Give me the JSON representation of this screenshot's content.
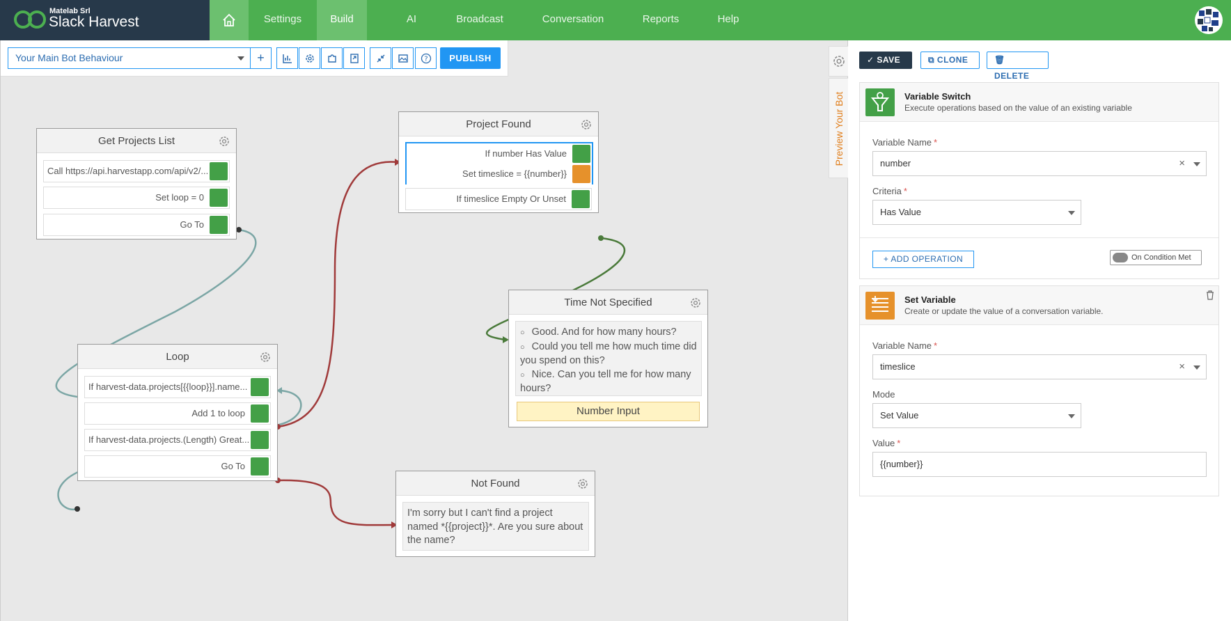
{
  "header": {
    "company": "Matelab Srl",
    "app_name": "Slack Harvest",
    "nav": [
      {
        "label": "Settings"
      },
      {
        "label": "Build"
      },
      {
        "label": "AI"
      },
      {
        "label": "Broadcast"
      },
      {
        "label": "Conversation"
      },
      {
        "label": "Reports"
      },
      {
        "label": "Help"
      }
    ],
    "active_nav": "Build",
    "brand_color": "#4caf50",
    "brand_dark": "#27394a"
  },
  "toolbar": {
    "behaviour_select": "Your Main Bot Behaviour",
    "publish_label": "PUBLISH",
    "tools": [
      "add-icon",
      "chart-icon",
      "gear-icon",
      "puzzle-icon",
      "export-icon",
      "collapse-icon",
      "image-icon",
      "help-icon"
    ]
  },
  "nodes": {
    "get_projects": {
      "title": "Get Projects List",
      "ops": [
        "Call https://api.harvestapp.com/api/v2/...",
        "Set loop = 0",
        "Go To"
      ]
    },
    "project_found": {
      "title": "Project Found",
      "ops": [
        "If number Has Value",
        "Set timeslice = {{number}}",
        "If timeslice Empty Or Unset"
      ]
    },
    "loop": {
      "title": "Loop",
      "ops": [
        "If harvest-data.projects[{{loop}}].name...",
        "Add 1 to loop",
        "If harvest-data.projects.(Length) Great...",
        "Go To"
      ]
    },
    "time_not_specified": {
      "title": "Time Not Specified",
      "messages": [
        "Good. And for how many hours?",
        "Could you tell me how much time did you spend on this?",
        "Nice. Can you tell me for how many hours?"
      ],
      "input_label": "Number Input"
    },
    "not_found": {
      "title": "Not Found",
      "message": "I'm sorry but I can't find a project named *{{project}}*. Are you sure about the name?"
    }
  },
  "panel": {
    "preview_tab": "Preview Your Bot",
    "save_label": "SAVE",
    "clone_label": "CLONE",
    "delete_label": "DELETE",
    "variable_switch": {
      "title": "Variable Switch",
      "description": "Execute operations based on the value of an existing variable",
      "variable_name_label": "Variable Name",
      "variable_name_value": "number",
      "criteria_label": "Criteria",
      "criteria_value": "Has Value",
      "add_operation_label": "ADD OPERATION",
      "condition_toggle": "On Condition Met"
    },
    "set_variable": {
      "title": "Set Variable",
      "description": "Create or update the value of a conversation variable.",
      "variable_name_label": "Variable Name",
      "variable_name_value": "timeslice",
      "mode_label": "Mode",
      "mode_value": "Set Value",
      "value_label": "Value",
      "value_value": "{{number}}"
    }
  }
}
